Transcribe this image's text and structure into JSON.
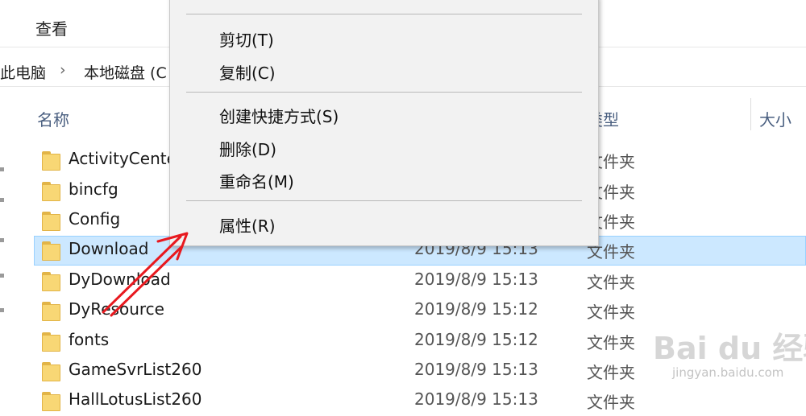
{
  "ribbon": {
    "tab_view": "查看"
  },
  "address": {
    "crumb_1": "此电脑",
    "separator": "›",
    "crumb_2": "本地磁盘 (C"
  },
  "columns": {
    "name": "名称",
    "type": "类型",
    "size": "大小"
  },
  "files": [
    {
      "name": "ActivityCenter",
      "date": "",
      "type": "文件夹"
    },
    {
      "name": "bincfg",
      "date": "",
      "type": "文件夹"
    },
    {
      "name": "Config",
      "date": "",
      "type": "文件夹"
    },
    {
      "name": "Download",
      "date": "2019/8/9 15:13",
      "type": "文件夹"
    },
    {
      "name": "DyDownload",
      "date": "2019/8/9 15:13",
      "type": "文件夹"
    },
    {
      "name": "DyResource",
      "date": "2019/8/9 15:12",
      "type": "文件夹"
    },
    {
      "name": "fonts",
      "date": "2019/8/9 15:12",
      "type": "文件夹"
    },
    {
      "name": "GameSvrList260",
      "date": "2019/8/9 15:13",
      "type": "文件夹"
    },
    {
      "name": "HallLotusList260",
      "date": "2019/8/9 15:13",
      "type": "文件夹"
    }
  ],
  "context_menu": {
    "items": [
      "剪切(T)",
      "复制(C)",
      "创建快捷方式(S)",
      "删除(D)",
      "重命名(M)",
      "属性(R)"
    ]
  },
  "watermark": {
    "logo": "Bai du 经验",
    "url": "jingyan.baidu.com"
  },
  "colors": {
    "selection_bg": "#cce8ff",
    "selection_border": "#99d1ff",
    "folder": "#f8d775",
    "arrow": "#e8191f"
  }
}
